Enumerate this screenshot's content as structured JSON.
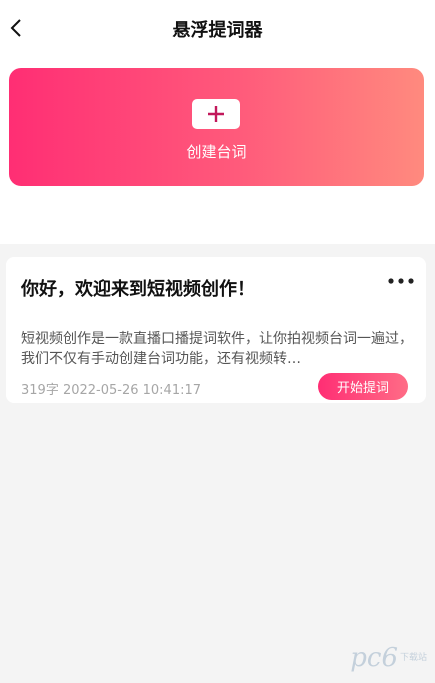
{
  "header": {
    "title": "悬浮提词器",
    "back_icon": "chevron-left-icon"
  },
  "create": {
    "label": "创建台词",
    "icon": "plus-icon"
  },
  "scripts": [
    {
      "title": "你好，欢迎来到短视频创作！",
      "body": "短视频创作是一款直播口播提词软件，让你拍视频台词一遍过，我们不仅有手动创建台词功能，还有视频转…",
      "meta": "319字 2022-05-26 10:41:17",
      "action": "开始提词",
      "more_icon": "more-horizontal-icon"
    }
  ],
  "watermark": {
    "logo": "pc6",
    "text": "下载站"
  },
  "colors": {
    "accent_start": "#ff2e74",
    "accent_end": "#ff8a7e",
    "list_bg": "#f4f4f4"
  }
}
